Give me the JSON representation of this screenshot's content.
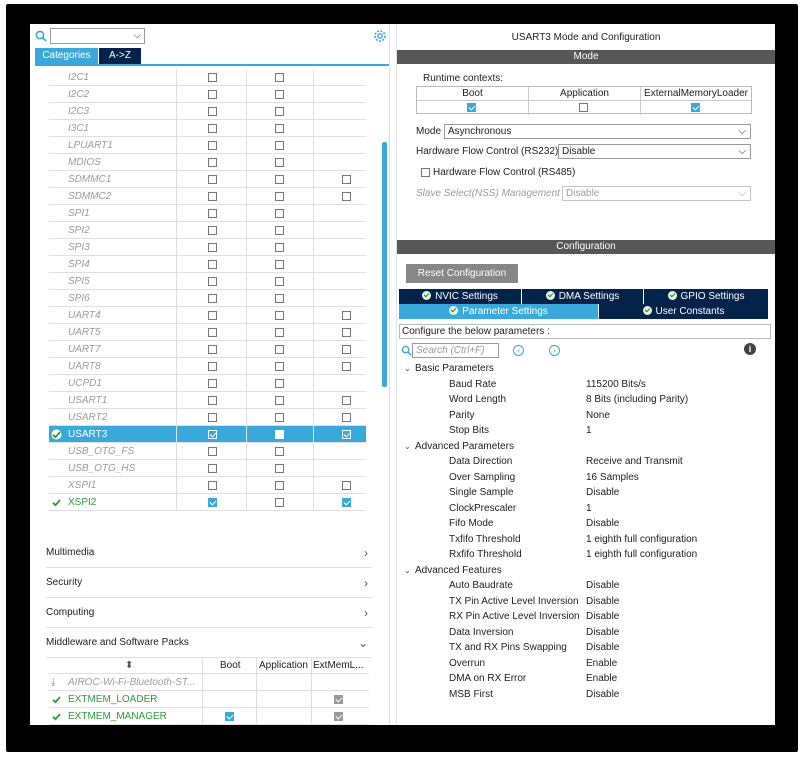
{
  "left": {
    "tabs": [
      "Categories",
      "A->Z"
    ],
    "peripherals": [
      {
        "name": "I2C1",
        "boot": false,
        "app": false,
        "ext": null,
        "state": "disabled"
      },
      {
        "name": "I2C2",
        "boot": false,
        "app": false,
        "ext": null,
        "state": "disabled"
      },
      {
        "name": "I2C3",
        "boot": false,
        "app": false,
        "ext": null,
        "state": "disabled"
      },
      {
        "name": "I3C1",
        "boot": false,
        "app": false,
        "ext": null,
        "state": "disabled"
      },
      {
        "name": "LPUART1",
        "boot": false,
        "app": false,
        "ext": null,
        "state": "disabled"
      },
      {
        "name": "MDIOS",
        "boot": false,
        "app": false,
        "ext": null,
        "state": "disabled"
      },
      {
        "name": "SDMMC1",
        "boot": false,
        "app": false,
        "ext": false,
        "state": "disabled"
      },
      {
        "name": "SDMMC2",
        "boot": false,
        "app": false,
        "ext": false,
        "state": "disabled"
      },
      {
        "name": "SPI1",
        "boot": false,
        "app": false,
        "ext": null,
        "state": "disabled"
      },
      {
        "name": "SPI2",
        "boot": false,
        "app": false,
        "ext": null,
        "state": "disabled"
      },
      {
        "name": "SPI3",
        "boot": false,
        "app": false,
        "ext": null,
        "state": "disabled"
      },
      {
        "name": "SPI4",
        "boot": false,
        "app": false,
        "ext": null,
        "state": "disabled"
      },
      {
        "name": "SPI5",
        "boot": false,
        "app": false,
        "ext": null,
        "state": "disabled"
      },
      {
        "name": "SPI6",
        "boot": false,
        "app": false,
        "ext": null,
        "state": "disabled"
      },
      {
        "name": "UART4",
        "boot": false,
        "app": false,
        "ext": false,
        "state": "disabled"
      },
      {
        "name": "UART5",
        "boot": false,
        "app": false,
        "ext": false,
        "state": "disabled"
      },
      {
        "name": "UART7",
        "boot": false,
        "app": false,
        "ext": false,
        "state": "disabled"
      },
      {
        "name": "UART8",
        "boot": false,
        "app": false,
        "ext": false,
        "state": "disabled"
      },
      {
        "name": "UCPD1",
        "boot": false,
        "app": false,
        "ext": null,
        "state": "disabled"
      },
      {
        "name": "USART1",
        "boot": false,
        "app": false,
        "ext": false,
        "state": "disabled"
      },
      {
        "name": "USART2",
        "boot": false,
        "app": false,
        "ext": false,
        "state": "disabled"
      },
      {
        "name": "USART3",
        "boot": true,
        "app": false,
        "ext": true,
        "state": "selected"
      },
      {
        "name": "USB_OTG_FS",
        "boot": false,
        "app": false,
        "ext": null,
        "state": "disabled"
      },
      {
        "name": "USB_OTG_HS",
        "boot": false,
        "app": false,
        "ext": null,
        "state": "disabled"
      },
      {
        "name": "XSPI1",
        "boot": false,
        "app": false,
        "ext": false,
        "state": "disabled"
      },
      {
        "name": "XSPI2",
        "boot": true,
        "app": false,
        "ext": true,
        "state": "enabled"
      }
    ],
    "categories": [
      "Multimedia",
      "Security",
      "Computing",
      "Middleware and Software Packs"
    ],
    "middleware_headers": [
      "Boot",
      "Application",
      "ExtMemL..."
    ],
    "middleware": [
      {
        "name": "AIROC-Wi-Fi-Bluetooth-ST...",
        "boot": null,
        "ext": null,
        "state": "pack"
      },
      {
        "name": "EXTMEM_LOADER",
        "boot": null,
        "ext": true,
        "state": "enabled"
      },
      {
        "name": "EXTMEM_MANAGER",
        "boot": true,
        "ext": true,
        "state": "enabled"
      }
    ]
  },
  "right": {
    "title": "USART3 Mode and Configuration",
    "mode_band": "Mode",
    "runtime_label": "Runtime contexts:",
    "runtime": [
      {
        "label": "Boot",
        "checked": true
      },
      {
        "label": "Application",
        "checked": false
      },
      {
        "label": "ExternalMemoryLoader",
        "checked": true
      }
    ],
    "mode_label": "Mode",
    "mode_value": "Asynchronous",
    "hwfc232_label": "Hardware Flow Control (RS232)",
    "hwfc232_value": "Disable",
    "hwfc485_label": "Hardware Flow Control (RS485)",
    "nss_label": "Slave Select(NSS) Management",
    "nss_value": "Disable",
    "config_band": "Configuration",
    "reset_label": "Reset Configuration",
    "tabs_row1": [
      "NVIC Settings",
      "DMA Settings",
      "GPIO Settings"
    ],
    "tabs_row2": [
      "Parameter Settings",
      "User Constants"
    ],
    "configure_text": "Configure the below parameters :",
    "search_placeholder": "Search (Ctrl+F)",
    "groups": [
      {
        "title": "Basic Parameters",
        "params": [
          [
            "Baud Rate",
            "115200 Bits/s"
          ],
          [
            "Word Length",
            "8 Bits (including Parity)"
          ],
          [
            "Parity",
            "None"
          ],
          [
            "Stop Bits",
            "1"
          ]
        ]
      },
      {
        "title": "Advanced Parameters",
        "params": [
          [
            "Data Direction",
            "Receive and Transmit"
          ],
          [
            "Over Sampling",
            "16 Samples"
          ],
          [
            "Single Sample",
            "Disable"
          ],
          [
            "ClockPrescaler",
            "1"
          ],
          [
            "Fifo Mode",
            "Disable"
          ],
          [
            "Txfifo Threshold",
            "1 eighth full configuration"
          ],
          [
            "Rxfifo Threshold",
            "1 eighth full configuration"
          ]
        ]
      },
      {
        "title": "Advanced Features",
        "params": [
          [
            "Auto Baudrate",
            "Disable"
          ],
          [
            "TX Pin Active Level Inversion",
            "Disable"
          ],
          [
            "RX Pin Active Level Inversion",
            "Disable"
          ],
          [
            "Data Inversion",
            "Disable"
          ],
          [
            "TX and RX Pins Swapping",
            "Disable"
          ],
          [
            "Overrun",
            "Enable"
          ],
          [
            "DMA on RX Error",
            "Enable"
          ],
          [
            "MSB First",
            "Disable"
          ]
        ]
      }
    ]
  },
  "colors": {
    "accent": "#39a9db",
    "navy": "#03234b",
    "band": "#575757",
    "green": "#2e9b3b"
  }
}
